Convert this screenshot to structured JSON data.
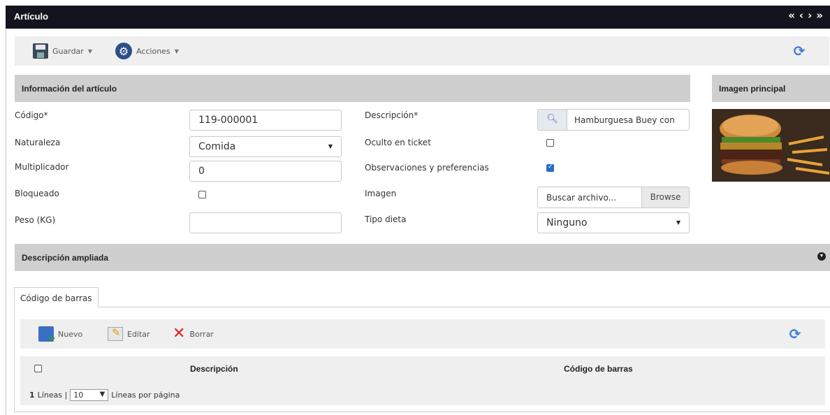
{
  "window": {
    "title": "Artículo",
    "nav": [
      "«",
      "‹",
      "›",
      "»"
    ]
  },
  "toolbar": {
    "save_label": "Guardar",
    "actions_label": "Acciones"
  },
  "section_info": {
    "title": "Información del artículo"
  },
  "section_image": {
    "title": "Imagen principal"
  },
  "fields": {
    "codigo": {
      "label": "Código*",
      "value": "119-000001"
    },
    "naturaleza": {
      "label": "Naturaleza",
      "value": "Comida"
    },
    "multiplicador": {
      "label": "Multiplicador",
      "value": "0"
    },
    "bloqueado": {
      "label": "Bloqueado",
      "checked": false
    },
    "peso": {
      "label": "Peso (KG)",
      "value": ""
    },
    "descripcion": {
      "label": "Descripción*",
      "value": "Hamburguesa Buey con"
    },
    "oculto": {
      "label": "Oculto en ticket",
      "checked": false
    },
    "observaciones": {
      "label": "Observaciones y preferencias",
      "checked": true
    },
    "imagen": {
      "label": "Imagen",
      "placeholder": "Buscar archivo...",
      "browse": "Browse"
    },
    "tipo_dieta": {
      "label": "Tipo dieta",
      "value": "Ninguno"
    }
  },
  "section_desc": {
    "title": "Descripción ampliada"
  },
  "tabs": [
    {
      "label": "Código de barras"
    }
  ],
  "grid_toolbar": {
    "new": "Nuevo",
    "edit": "Editar",
    "delete": "Borrar"
  },
  "grid": {
    "columns": [
      "Descripción",
      "Código de barras"
    ],
    "pager": {
      "count": "1",
      "lines_label": "Líneas |",
      "page_size": "10",
      "per_page_label": "Líneas por página"
    }
  }
}
